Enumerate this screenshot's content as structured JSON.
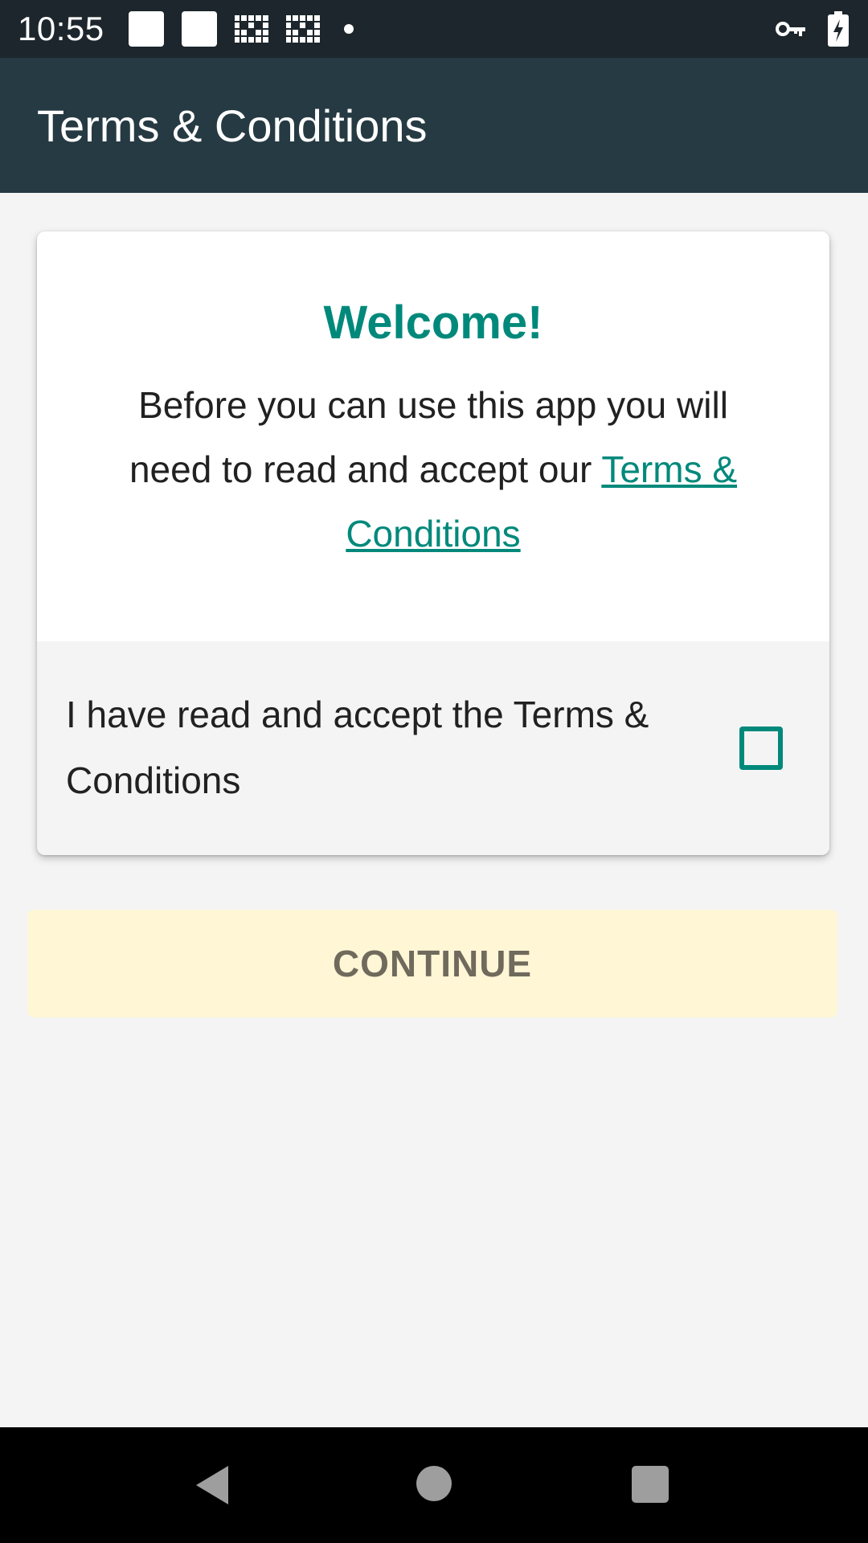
{
  "status_bar": {
    "time": "10:55",
    "icons": [
      "notification-icon",
      "notification-icon",
      "app-icon",
      "app-icon",
      "dot-icon",
      "vpn-key-icon",
      "battery-charging-icon"
    ]
  },
  "app_bar": {
    "title": "Terms & Conditions"
  },
  "card": {
    "welcome": "Welcome!",
    "intro_text": "Before you can use this app you will need to read and accept our ",
    "terms_link": "Terms & Conditions",
    "accept_label": "I have read and accept the Terms & Conditions",
    "checkbox_checked": false
  },
  "continue_button": {
    "label": "CONTINUE"
  },
  "colors": {
    "accent": "#00897b",
    "app_bar": "#263a43",
    "status_bar": "#1c262c",
    "button_bg": "#fff6d6"
  },
  "nav_bar": {
    "buttons": [
      "back-icon",
      "home-icon",
      "recents-icon"
    ]
  }
}
